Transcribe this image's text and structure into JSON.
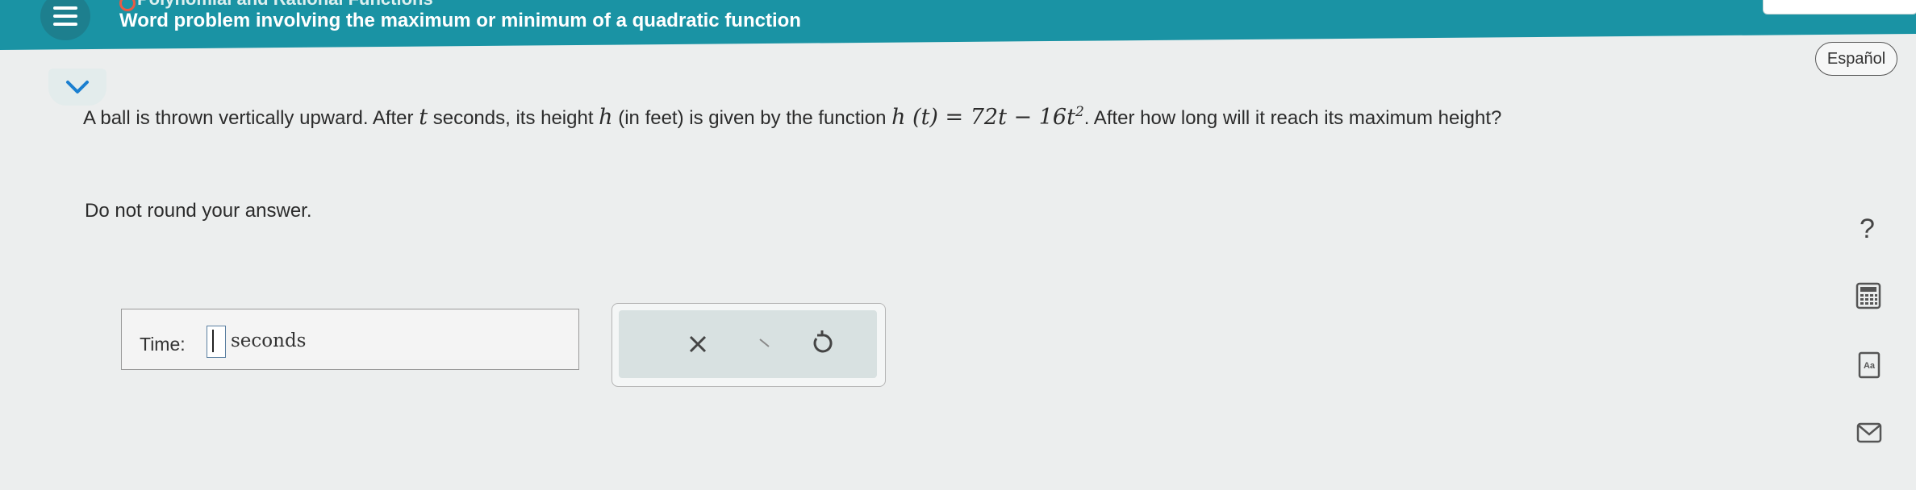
{
  "header": {
    "topic": "Polynomial and Rational Functions",
    "title": "Word problem involving the maximum or minimum of a quadratic function"
  },
  "language_button": "Español",
  "question": {
    "text_1": "A ball is thrown vertically upward. After ",
    "var_t": "t",
    "text_2": " seconds, its height ",
    "var_h": "h",
    "text_3": " (in feet) is given by the function ",
    "formula_main": "h (t) = 72t − 16t",
    "formula_exp": "2",
    "text_4": ". After how long will it reach its maximum height?",
    "instruction": "Do not round your answer."
  },
  "answer": {
    "label": "Time:",
    "unit": "seconds",
    "value": ""
  },
  "side_tools": {
    "help": "?",
    "icons": [
      "calculator-icon",
      "text-size-icon",
      "mail-icon"
    ]
  },
  "colors": {
    "header_bg": "#1a93a4",
    "page_bg": "#eceeee",
    "accent": "#1a7fd0"
  }
}
